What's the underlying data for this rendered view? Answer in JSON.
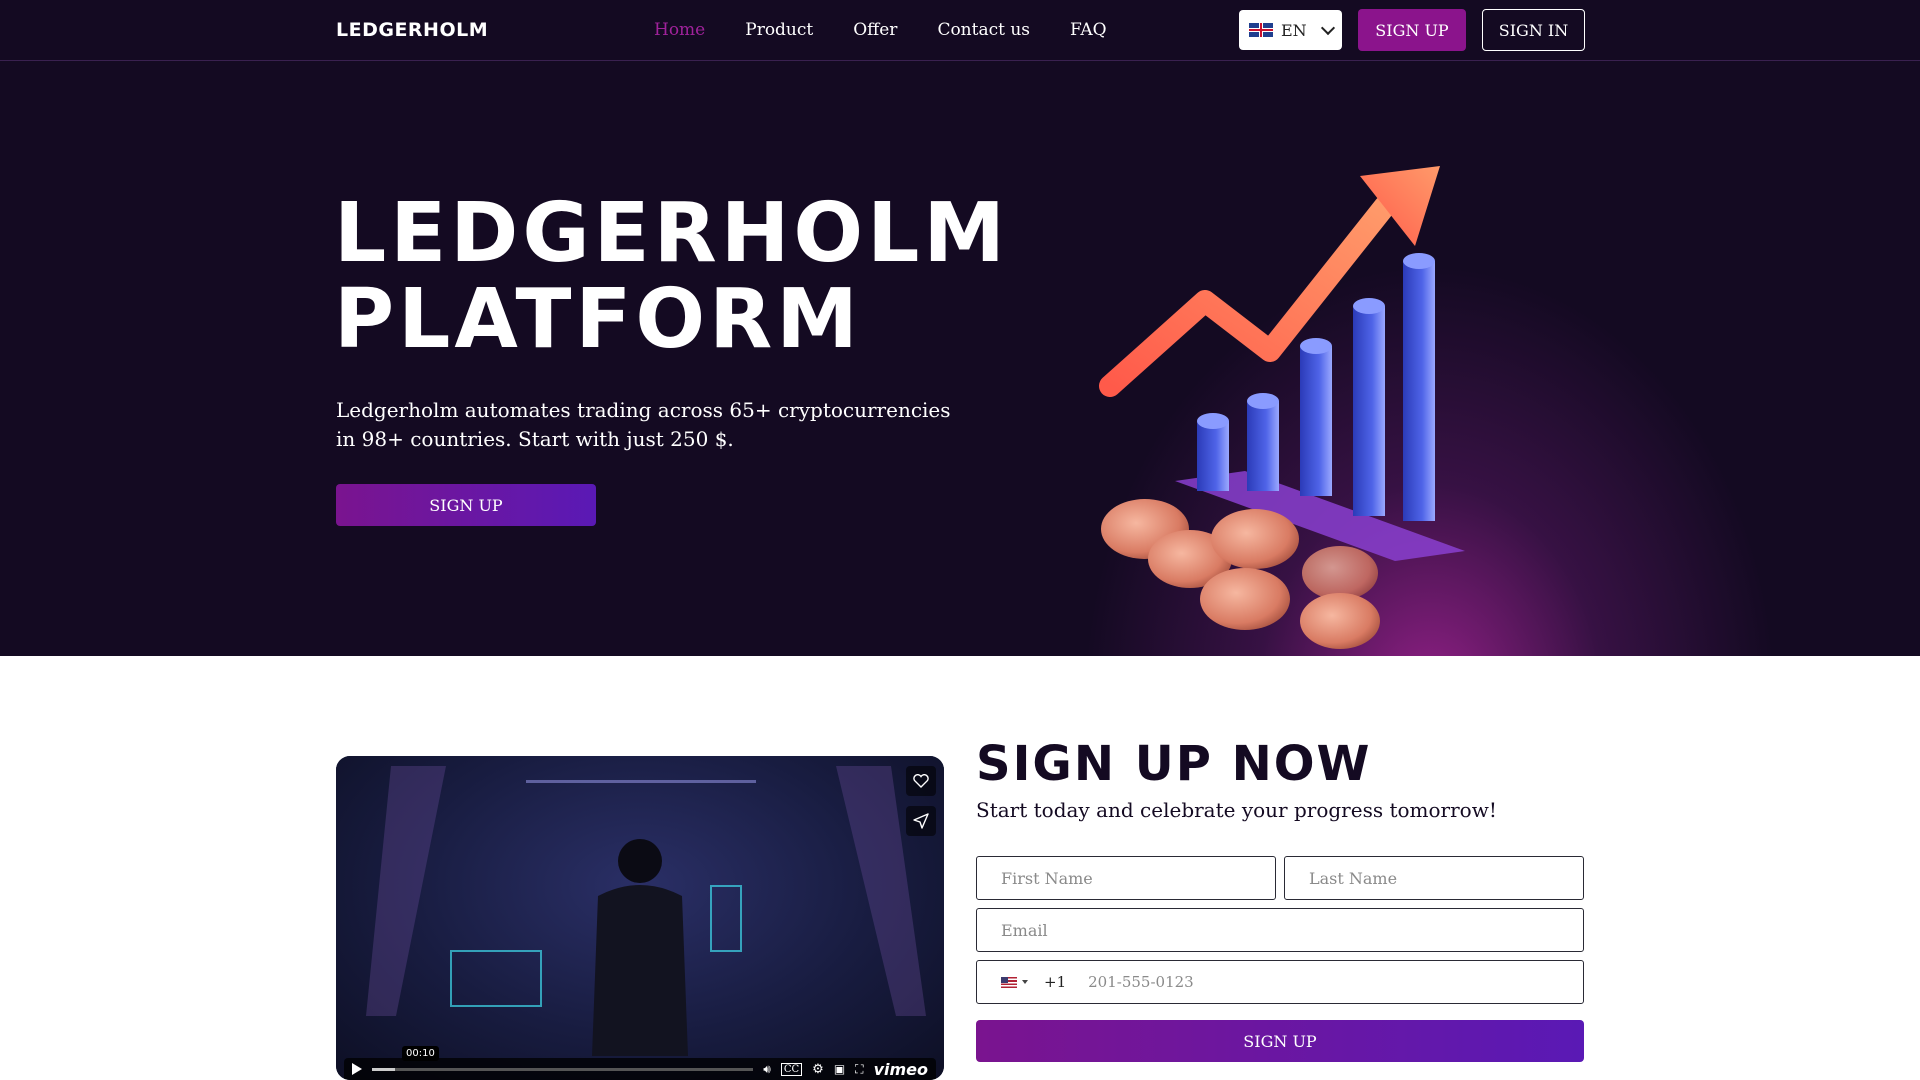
{
  "brand": {
    "logo": "LEDGERHOLM"
  },
  "nav": {
    "items": [
      {
        "label": "Home",
        "active": true
      },
      {
        "label": "Product"
      },
      {
        "label": "Offer"
      },
      {
        "label": "Contact us"
      },
      {
        "label": "FAQ"
      }
    ],
    "language": {
      "flag_icon": "uk-flag-icon",
      "code": "EN"
    },
    "signup_label": "SIGN UP",
    "signin_label": "SIGN IN"
  },
  "hero": {
    "title_line1": "LEDGERHOLM",
    "title_line2": "PLATFORM",
    "description": "Ledgerholm automates trading across 65+ cryptocurrencies in 98+ countries. Start with just 250 $.",
    "cta_label": "SIGN UP",
    "illustration": "growth-chart-with-coins-illustration"
  },
  "video": {
    "time": "00:10",
    "brand": "vimeo",
    "icons": [
      "heart-icon",
      "send-icon",
      "play-icon",
      "volume-icon",
      "cc-icon",
      "settings-icon",
      "pip-icon",
      "fullscreen-icon"
    ]
  },
  "signup": {
    "title": "SIGN UP NOW",
    "subtitle": "Start today and celebrate your progress tomorrow!",
    "first_name_placeholder": "First Name",
    "last_name_placeholder": "Last Name",
    "email_placeholder": "Email",
    "phone_flag_icon": "us-flag-icon",
    "dial_code": "+1",
    "phone_placeholder": "201-555-0123",
    "submit_label": "SIGN UP"
  },
  "colors": {
    "nav_bg": "#140a22",
    "accent": "#8b148c",
    "active_link": "#a0229b",
    "gradient_start": "#7a148f",
    "gradient_end": "#5a19b5"
  }
}
